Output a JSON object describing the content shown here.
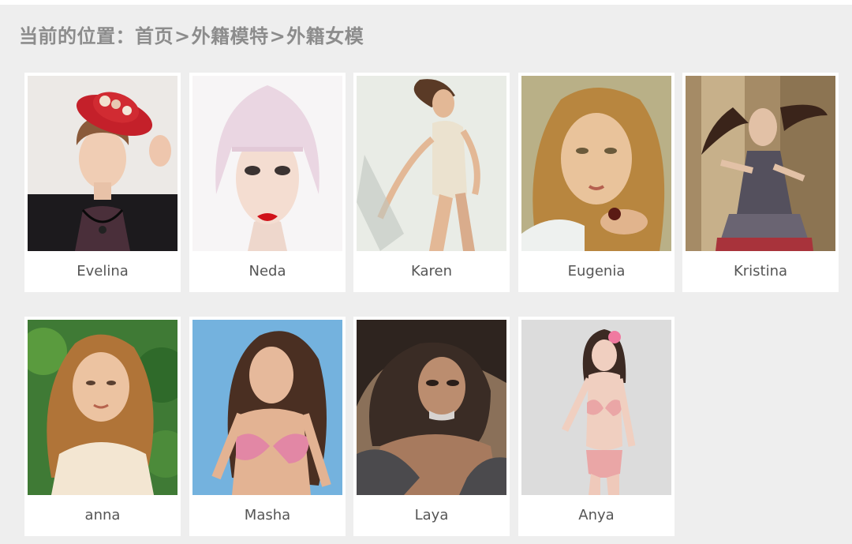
{
  "breadcrumb": {
    "label": "当前的位置：",
    "home": "首页",
    "sep1": ">",
    "category": "外籍模特",
    "sep2": ">",
    "current": "外籍女模"
  },
  "models": [
    {
      "name": "Evelina",
      "photo": "model-photo-evelina"
    },
    {
      "name": "Neda",
      "photo": "model-photo-neda"
    },
    {
      "name": "Karen",
      "photo": "model-photo-karen"
    },
    {
      "name": "Eugenia",
      "photo": "model-photo-eugenia"
    },
    {
      "name": "Kristina",
      "photo": "model-photo-kristina"
    },
    {
      "name": "anna",
      "photo": "model-photo-anna"
    },
    {
      "name": "Masha",
      "photo": "model-photo-masha"
    },
    {
      "name": "Laya",
      "photo": "model-photo-laya"
    },
    {
      "name": "Anya",
      "photo": "model-photo-anya"
    }
  ],
  "colors": {
    "background": "#eeeeee",
    "card": "#ffffff",
    "breadcrumb_text": "#8c8c8c",
    "name_text": "#555555"
  }
}
